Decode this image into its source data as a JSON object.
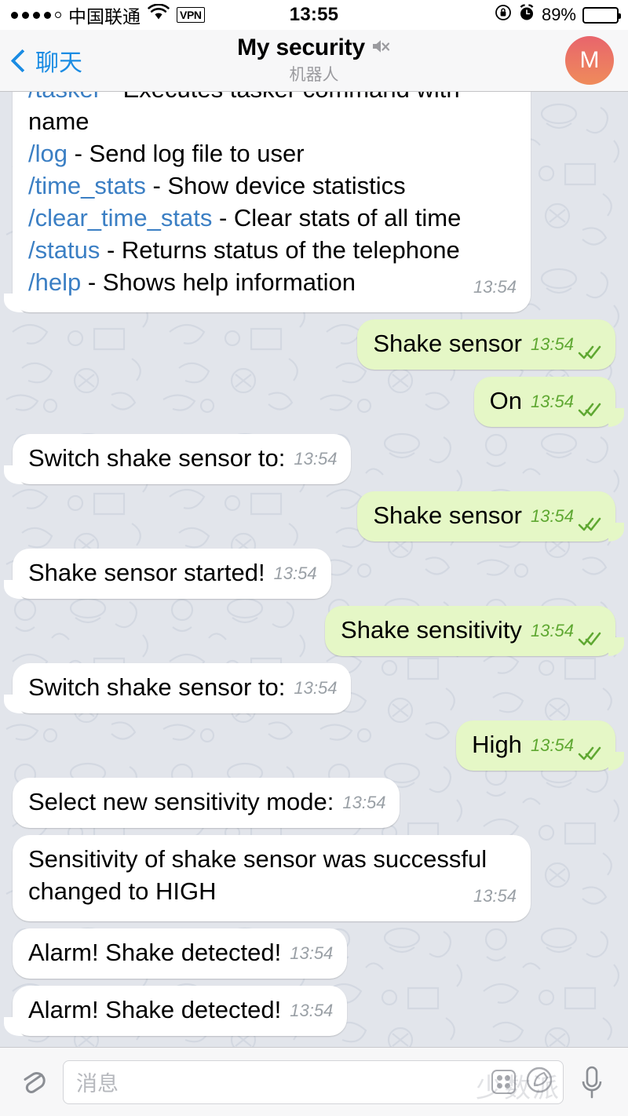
{
  "statusbar": {
    "carrier": "中国联通",
    "signal_dots_filled": 4,
    "signal_dots_total": 5,
    "wifi_icon": "wifi-icon",
    "vpn_label": "VPN",
    "time": "13:55",
    "rotation_lock_icon": "rotation-lock-icon",
    "alarm_icon": "alarm-clock-icon",
    "battery_percent": "89%",
    "battery_level": 89
  },
  "navbar": {
    "back_label": "聊天",
    "back_icon": "chevron-left-icon",
    "title": "My security",
    "mute_icon": "muted-speaker-icon",
    "subtitle": "机器人",
    "avatar_letter": "M",
    "avatar_color_top": "#e8656c",
    "avatar_color_bottom": "#ef8b5b",
    "accent_color": "#1b8ce3"
  },
  "chat": {
    "background_color": "#e2e5eb",
    "incoming_bubble_color": "#ffffff",
    "outgoing_bubble_color": "#e5f7c6",
    "command_link_color": "#3b7fc4",
    "messages": [
      {
        "id": "m1",
        "side": "in",
        "tail": true,
        "multiline": true,
        "time": "13:54",
        "lines": [
          {
            "cmd": "/tasker",
            "text": " - Executes tasker command with name"
          },
          {
            "cmd": "/log",
            "text": " - Send log file to user"
          },
          {
            "cmd": "/time_stats",
            "text": " - Show device statistics"
          },
          {
            "cmd": "/clear_time_stats",
            "text": " - Clear stats of all time"
          },
          {
            "cmd": "/status",
            "text": " - Returns status of the telephone"
          },
          {
            "cmd": "/help",
            "text": " - Shows help information"
          }
        ]
      },
      {
        "id": "m2",
        "side": "out",
        "tail": false,
        "text": "Shake sensor",
        "time": "13:54",
        "status": "read"
      },
      {
        "id": "m3",
        "side": "out",
        "tail": true,
        "text": "On",
        "time": "13:54",
        "status": "read"
      },
      {
        "id": "m4",
        "side": "in",
        "tail": true,
        "text": "Switch shake sensor to:",
        "time": "13:54"
      },
      {
        "id": "m5",
        "side": "out",
        "tail": true,
        "text": "Shake sensor",
        "time": "13:54",
        "status": "read"
      },
      {
        "id": "m6",
        "side": "in",
        "tail": true,
        "text": "Shake sensor started!",
        "time": "13:54"
      },
      {
        "id": "m7",
        "side": "out",
        "tail": true,
        "text": "Shake sensitivity",
        "time": "13:54",
        "status": "read"
      },
      {
        "id": "m8",
        "side": "in",
        "tail": true,
        "text": "Switch shake sensor to:",
        "time": "13:54"
      },
      {
        "id": "m9",
        "side": "out",
        "tail": true,
        "text": "High",
        "time": "13:54",
        "status": "read"
      },
      {
        "id": "m10",
        "side": "in",
        "tail": false,
        "text": "Select new sensitivity mode:",
        "time": "13:54"
      },
      {
        "id": "m11",
        "side": "in",
        "tail": false,
        "multiline": true,
        "text": "Sensitivity of shake sensor was successful changed to HIGH",
        "time": "13:54"
      },
      {
        "id": "m12",
        "side": "in",
        "tail": false,
        "text": "Alarm! Shake detected!",
        "time": "13:54"
      },
      {
        "id": "m13",
        "side": "in",
        "tail": true,
        "text": "Alarm! Shake detected!",
        "time": "13:54"
      }
    ]
  },
  "inputbar": {
    "attach_icon": "paperclip-icon",
    "placeholder": "消息",
    "keyboard_icon": "grid-keyboard-icon",
    "sticker_icon": "sticker-icon",
    "mic_icon": "microphone-icon",
    "watermark": "少数派"
  }
}
